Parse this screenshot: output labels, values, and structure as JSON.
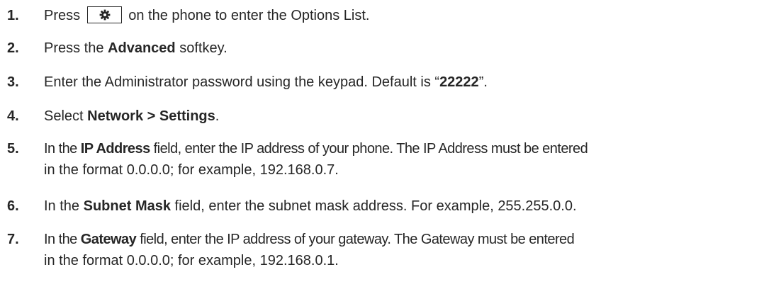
{
  "steps": [
    {
      "number": "1.",
      "before": "Press",
      "key_icon": "gear-icon",
      "after": "on the phone to enter the Options List."
    },
    {
      "number": "2.",
      "before": "Press the",
      "bold": "Advanced",
      "after": "softkey."
    },
    {
      "number": "3.",
      "before": "Enter the Administrator password using the keypad. Default is “",
      "bold": "22222",
      "after": "”."
    },
    {
      "number": "4.",
      "before": "Select",
      "bold": "Network > Settings",
      "after": "."
    },
    {
      "number": "5.",
      "before": "In the",
      "bold": "IP Address",
      "after": "field, enter the IP address of your phone. The IP Address must be entered",
      "line2": "in the format 0.0.0.0; for example, 192.168.0.7."
    },
    {
      "number": "6.",
      "before": "In the",
      "bold": "Subnet Mask",
      "after": "field, enter the subnet mask address. For example, 255.255.0.0."
    },
    {
      "number": "7.",
      "before": "In the",
      "bold": "Gateway",
      "after": "field, enter the IP address of your gateway. The Gateway must be entered",
      "line2": "in the format 0.0.0.0; for example, 192.168.0.1."
    }
  ]
}
